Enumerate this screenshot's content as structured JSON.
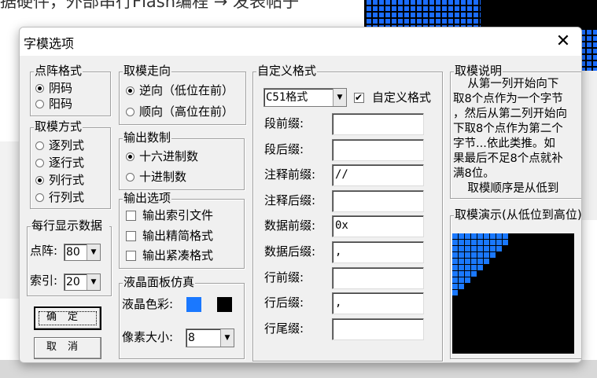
{
  "background": {
    "top_text": "据硬件，外部串行Flash编程 → 发表帖子"
  },
  "dialog": {
    "title": "字模选项",
    "close_glyph": "✕"
  },
  "matrix_format": {
    "title": "点阵格式",
    "options": [
      "阴码",
      "阳码"
    ],
    "selected": 0
  },
  "scan_mode": {
    "title": "取模方式",
    "options": [
      "逐列式",
      "逐行式",
      "列行式",
      "行列式"
    ],
    "selected": 2
  },
  "per_line": {
    "title": "每行显示数据",
    "dot_label": "点阵:",
    "dot_value": "80",
    "index_label": "索引:",
    "index_value": "20"
  },
  "buttons": {
    "ok": "确定",
    "cancel": "取消"
  },
  "direction": {
    "title": "取模走向",
    "options": [
      "逆向（低位在前）",
      "顺向（高位在前）"
    ],
    "selected": 0
  },
  "number_base": {
    "title": "输出数制",
    "options": [
      "十六进制数",
      "十进制数"
    ],
    "selected": 0
  },
  "output_options": {
    "title": "输出选项",
    "options": [
      "输出索引文件",
      "输出精简格式",
      "输出紧凑格式"
    ],
    "checked": [
      false,
      false,
      false
    ]
  },
  "lcd_sim": {
    "title": "液晶面板仿真",
    "color_label": "液晶色彩:",
    "pixel_label": "像素大小:",
    "pixel_value": "8",
    "fg_color": "#1a78ff",
    "bg_color": "#000000"
  },
  "custom_format": {
    "title": "自定义格式",
    "format_value": "C51格式",
    "custom_checkbox_label": "自定义格式",
    "custom_checked": true,
    "fields": [
      {
        "label": "段前缀:",
        "value": ""
      },
      {
        "label": "段后缀:",
        "value": ""
      },
      {
        "label": "注释前缀:",
        "value": "//"
      },
      {
        "label": "注释后缀:",
        "value": ""
      },
      {
        "label": "数据前缀:",
        "value": "0x"
      },
      {
        "label": "数据后缀:",
        "value": ","
      },
      {
        "label": "行前缀:",
        "value": ""
      },
      {
        "label": "行后缀:",
        "value": ","
      },
      {
        "label": "行尾缀:",
        "value": ""
      }
    ]
  },
  "description": {
    "title": "取模说明",
    "lines": [
      "    从第一列开始向下",
      "取8个点作为一个字节",
      "，然后从第二列开始向",
      "下取8个点作为第二个",
      "字节...依此类推。如",
      "果最后不足8个点就补",
      "满8位。",
      "    取模顺序是从低到"
    ]
  },
  "demo": {
    "title": "取模演示(从低位到高位)",
    "lit_color": "#1a78ff",
    "cells_lit": [
      [
        1,
        1,
        1,
        1,
        1,
        1,
        1,
        1,
        1,
        0,
        0,
        0,
        0,
        0,
        0,
        0,
        0,
        0,
        0,
        0
      ],
      [
        1,
        1,
        1,
        1,
        1,
        1,
        1,
        1,
        1,
        0,
        0,
        0,
        0,
        0,
        0,
        0,
        0,
        0,
        0,
        0
      ],
      [
        1,
        1,
        1,
        1,
        1,
        1,
        1,
        1,
        0,
        0,
        0,
        0,
        0,
        0,
        0,
        0,
        0,
        0,
        0,
        0
      ],
      [
        1,
        1,
        1,
        1,
        1,
        1,
        1,
        0,
        0,
        0,
        0,
        0,
        0,
        0,
        0,
        0,
        0,
        0,
        0,
        0
      ],
      [
        1,
        1,
        1,
        1,
        1,
        1,
        0,
        0,
        0,
        0,
        0,
        0,
        0,
        0,
        0,
        0,
        0,
        0,
        0,
        0
      ],
      [
        1,
        1,
        1,
        1,
        1,
        0,
        0,
        0,
        0,
        0,
        0,
        0,
        0,
        0,
        0,
        0,
        0,
        0,
        0,
        0
      ],
      [
        1,
        1,
        1,
        1,
        0,
        0,
        0,
        0,
        0,
        0,
        0,
        0,
        0,
        0,
        0,
        0,
        0,
        0,
        0,
        0
      ],
      [
        1,
        1,
        1,
        0,
        0,
        0,
        0,
        0,
        0,
        0,
        0,
        0,
        0,
        0,
        0,
        0,
        0,
        0,
        0,
        0
      ],
      [
        1,
        1,
        0,
        0,
        0,
        0,
        0,
        0,
        0,
        0,
        0,
        0,
        0,
        0,
        0,
        0,
        0,
        0,
        0,
        0
      ],
      [
        1,
        0,
        0,
        0,
        0,
        0,
        0,
        0,
        0,
        0,
        0,
        0,
        0,
        0,
        0,
        0,
        0,
        0,
        0,
        0
      ]
    ]
  }
}
